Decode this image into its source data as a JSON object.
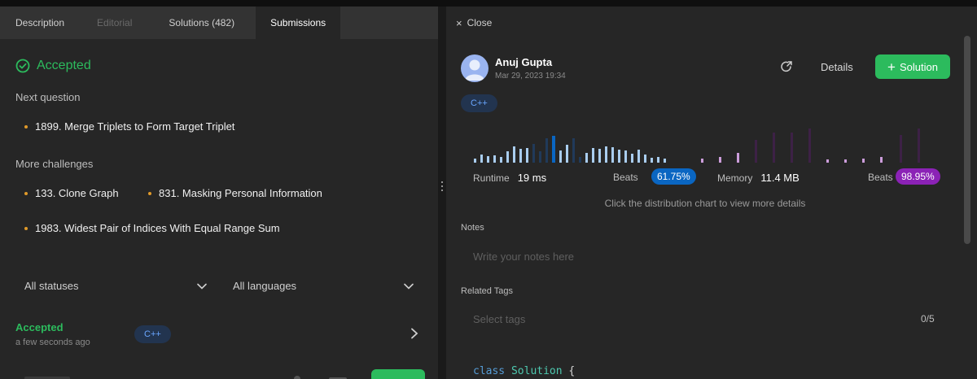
{
  "left": {
    "tabs": [
      {
        "label": "Description"
      },
      {
        "label": "Editorial"
      },
      {
        "label": "Solutions (482)"
      },
      {
        "label": "Submissions"
      }
    ],
    "status": "Accepted",
    "next_question_title": "Next question",
    "next_question": "1899. Merge Triplets to Form Target Triplet",
    "more_challenges_title": "More challenges",
    "challenges": [
      "133. Clone Graph",
      "831. Masking Personal Information",
      "1983. Widest Pair of Indices With Equal Range Sum"
    ],
    "filters": {
      "status": "All statuses",
      "language": "All languages"
    },
    "submission": {
      "status": "Accepted",
      "time": "a few seconds ago",
      "language": "C++"
    }
  },
  "right": {
    "close_label": "Close",
    "user_name": "Anuj Gupta",
    "date": "Mar 29, 2023 19:34",
    "details_label": "Details",
    "solution_label": "Solution",
    "language": "C++",
    "runtime": {
      "label": "Runtime",
      "value": "19 ms",
      "beats_label": "Beats",
      "beats": "61.75%"
    },
    "memory": {
      "label": "Memory",
      "value": "11.4 MB",
      "beats_label": "Beats",
      "beats": "98.95%"
    },
    "hint": "Click the distribution chart to view more details",
    "notes_label": "Notes",
    "notes_placeholder": "Write your notes here",
    "tags_label": "Related Tags",
    "tags_placeholder": "Select tags",
    "tags_count": "0/5",
    "code": {
      "kw": "class",
      "name": "Solution",
      "brace": "{"
    }
  },
  "colors": {
    "accent_green": "#2cbb5d",
    "runtime_blue": "#0a66c2",
    "memory_purple": "#8b22b6",
    "pill_blue_text": "#6aa6ff"
  }
}
